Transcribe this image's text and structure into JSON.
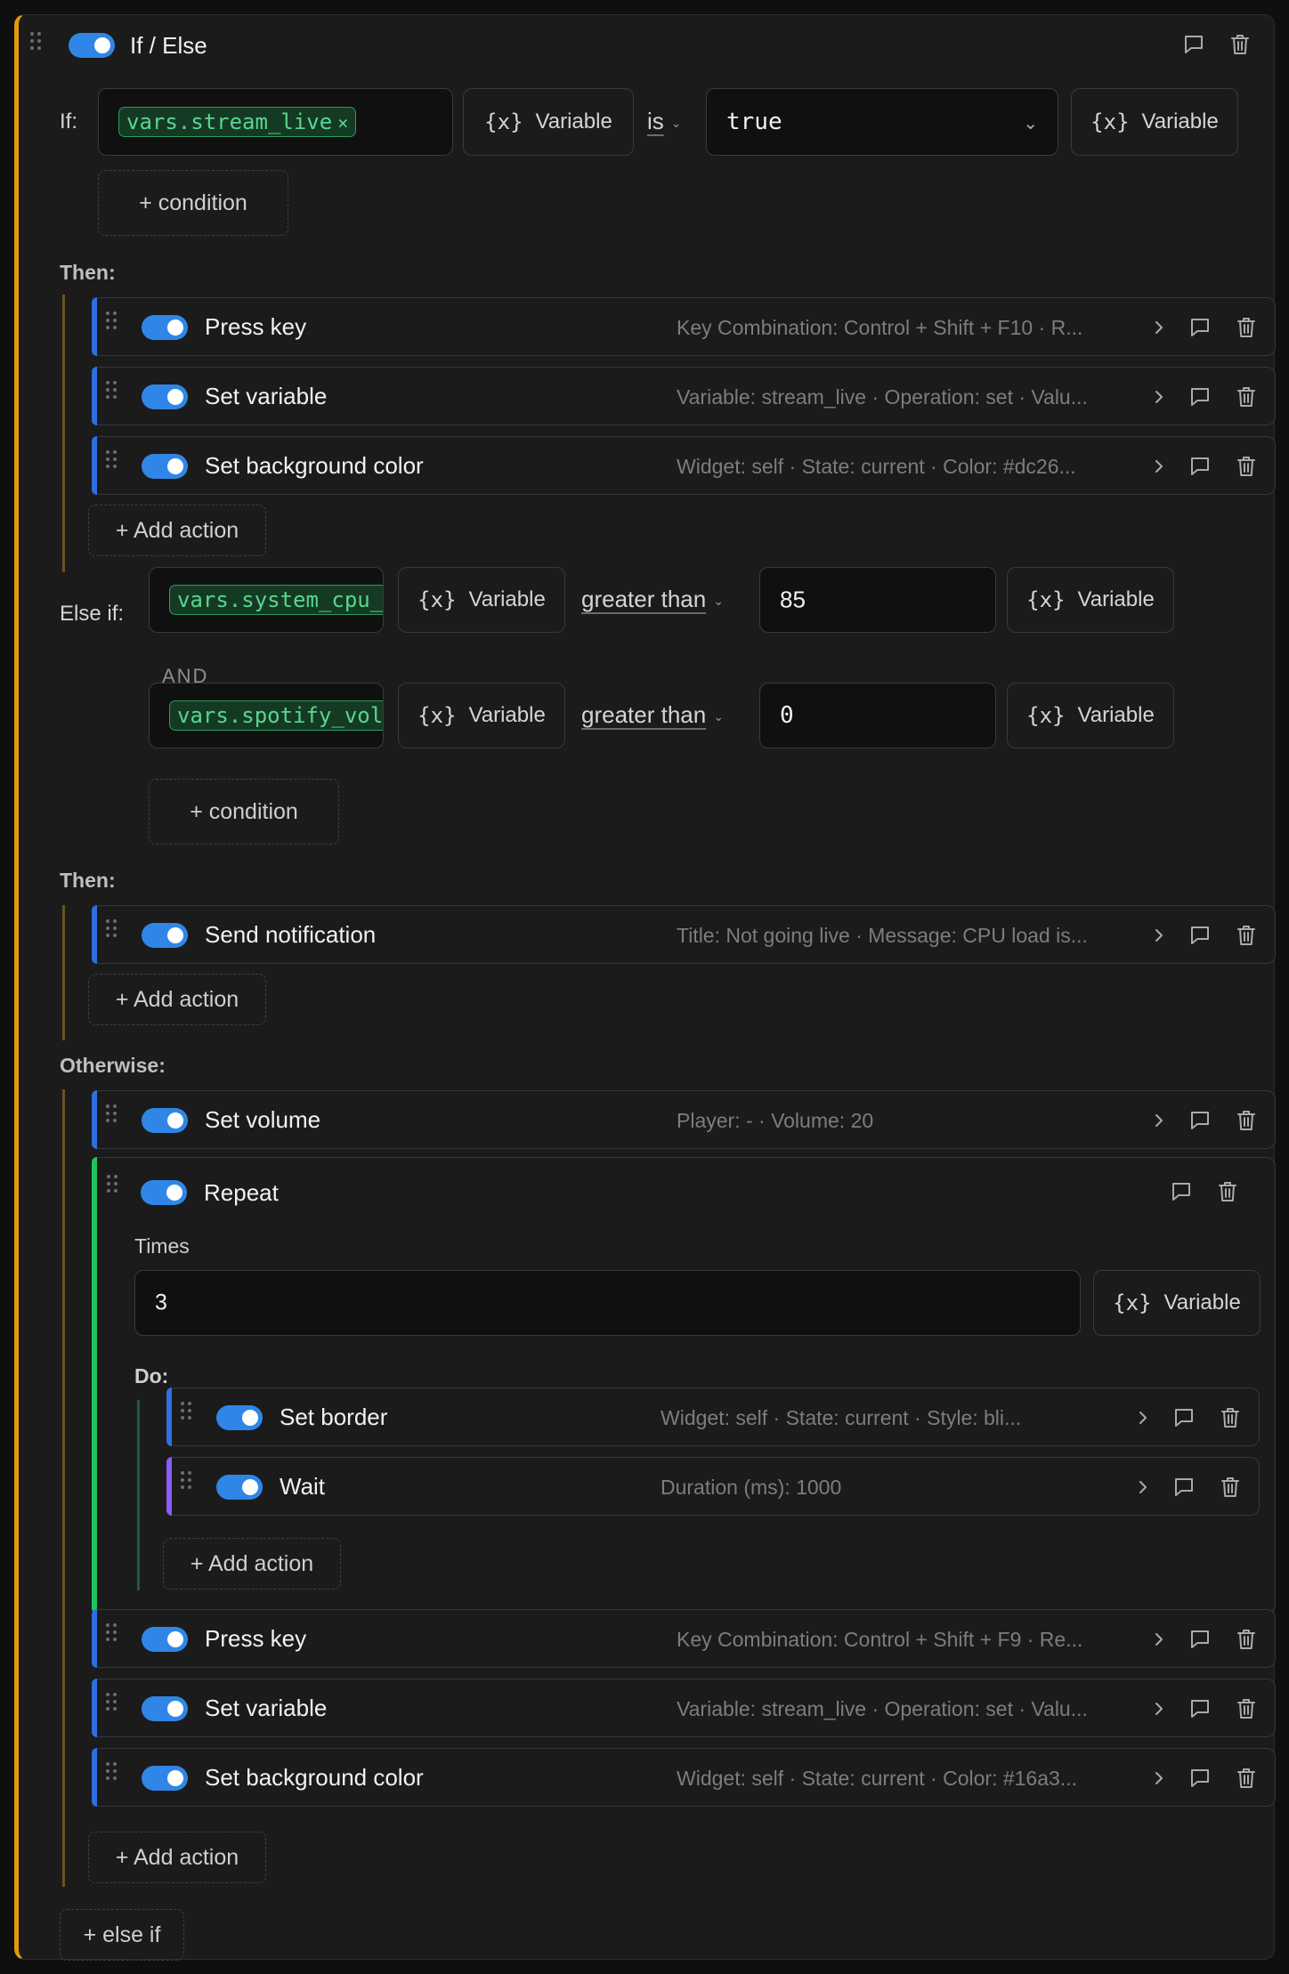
{
  "header": {
    "title": "If / Else"
  },
  "colors": {
    "ifelse_accent": "#e39a0e",
    "action_accent": "#2f6fe0",
    "repeat_accent": "#22c35e",
    "wait_accent": "#8b5cf6",
    "toggle_on": "#2f86e6"
  },
  "if_block": {
    "label": "If:",
    "variable": "vars.stream_live",
    "variable_button": "Variable",
    "operator": "is",
    "value": "true",
    "add_condition": "+ condition"
  },
  "then1": {
    "label": "Then:",
    "actions": [
      {
        "title": "Press key",
        "summary": "Key Combination: Control + Shift + F10 · R..."
      },
      {
        "title": "Set variable",
        "summary": "Variable: stream_live · Operation: set · Valu..."
      },
      {
        "title": "Set background color",
        "summary": "Widget: self · State: current · Color: #dc26..."
      }
    ],
    "add_action": "+ Add action"
  },
  "elseif_block": {
    "label": "Else if:",
    "conditions": [
      {
        "variable": "vars.system_cpu_u",
        "variable_button": "Variable",
        "operator": "greater than",
        "value": "85",
        "value_button": "Variable"
      },
      {
        "variable": "vars.spotify_volu",
        "variable_button": "Variable",
        "operator": "greater than",
        "value": "0",
        "value_button": "Variable"
      }
    ],
    "joiner": "AND",
    "add_condition": "+ condition"
  },
  "then2": {
    "label": "Then:",
    "actions": [
      {
        "title": "Send notification",
        "summary": "Title: Not going live · Message: CPU load is..."
      }
    ],
    "add_action": "+ Add action"
  },
  "otherwise": {
    "label": "Otherwise:",
    "set_volume": {
      "title": "Set volume",
      "summary": "Player: - · Volume: 20"
    },
    "repeat": {
      "title": "Repeat",
      "times_label": "Times",
      "times_value": "3",
      "variable_button": "Variable",
      "do_label": "Do:",
      "actions": [
        {
          "title": "Set border",
          "summary": "Widget: self · State: current · Style: bli..."
        },
        {
          "title": "Wait",
          "summary": "Duration (ms): 1000"
        }
      ],
      "add_action": "+ Add action"
    },
    "actions": [
      {
        "title": "Press key",
        "summary": "Key Combination: Control + Shift + F9 · Re..."
      },
      {
        "title": "Set variable",
        "summary": "Variable: stream_live · Operation: set · Valu..."
      },
      {
        "title": "Set background color",
        "summary": "Widget: self · State: current · Color: #16a3..."
      }
    ],
    "add_action": "+ Add action"
  },
  "add_else_if": "+ else if",
  "icons": {
    "grip": "grip-icon",
    "comment": "comment-icon",
    "delete": "trash-icon",
    "expand": "chevron-right-icon",
    "dropdown": "chevron-down-icon"
  }
}
